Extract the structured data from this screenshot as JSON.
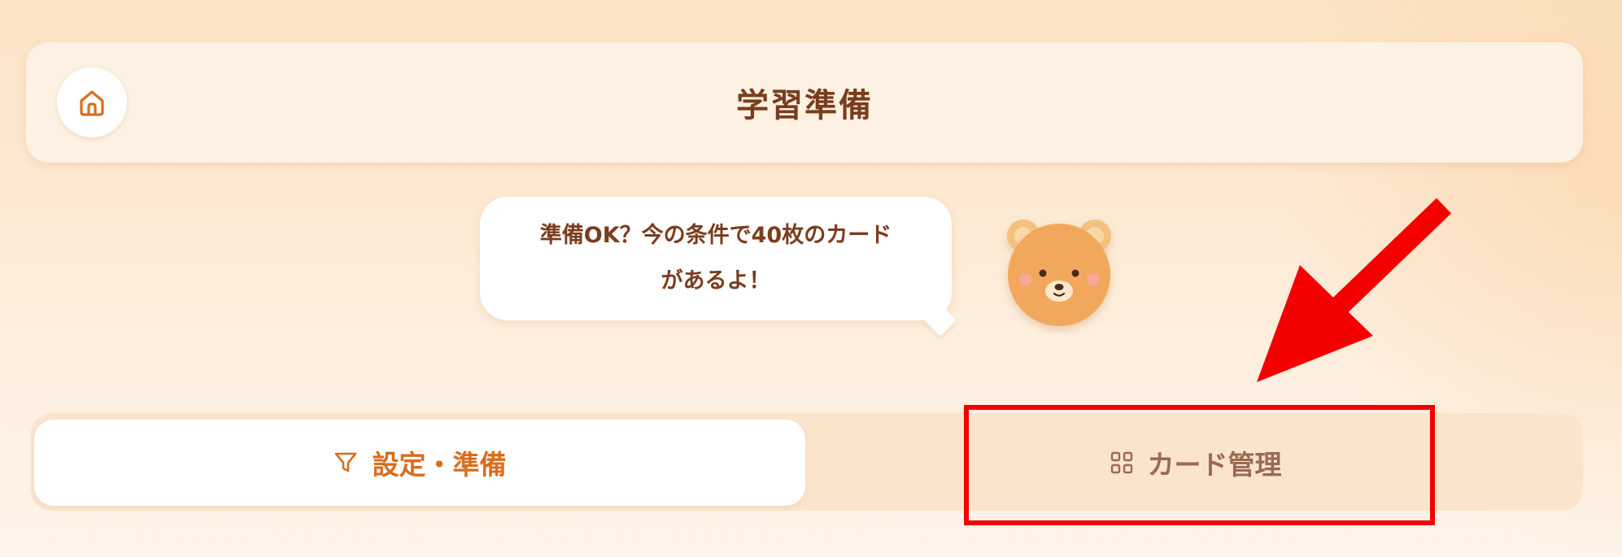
{
  "header": {
    "title": "学習準備",
    "home_icon": "home-icon"
  },
  "mascot": {
    "bubble_line1": "準備OK？今の条件で40枚のカード",
    "bubble_line2": "があるよ！",
    "icon": "bear-icon"
  },
  "tabs": [
    {
      "label": "設定・準備",
      "icon": "filter-icon",
      "active": true
    },
    {
      "label": "カード管理",
      "icon": "grid-icon",
      "active": false
    }
  ],
  "annotation": {
    "highlight_color": "#f50000",
    "arrow_color": "#f50000"
  },
  "colors": {
    "accent": "#d86e1f",
    "title_text": "#7a3d1e",
    "inactive_tab_text": "#9a6a52",
    "background": "#fde9d2"
  }
}
